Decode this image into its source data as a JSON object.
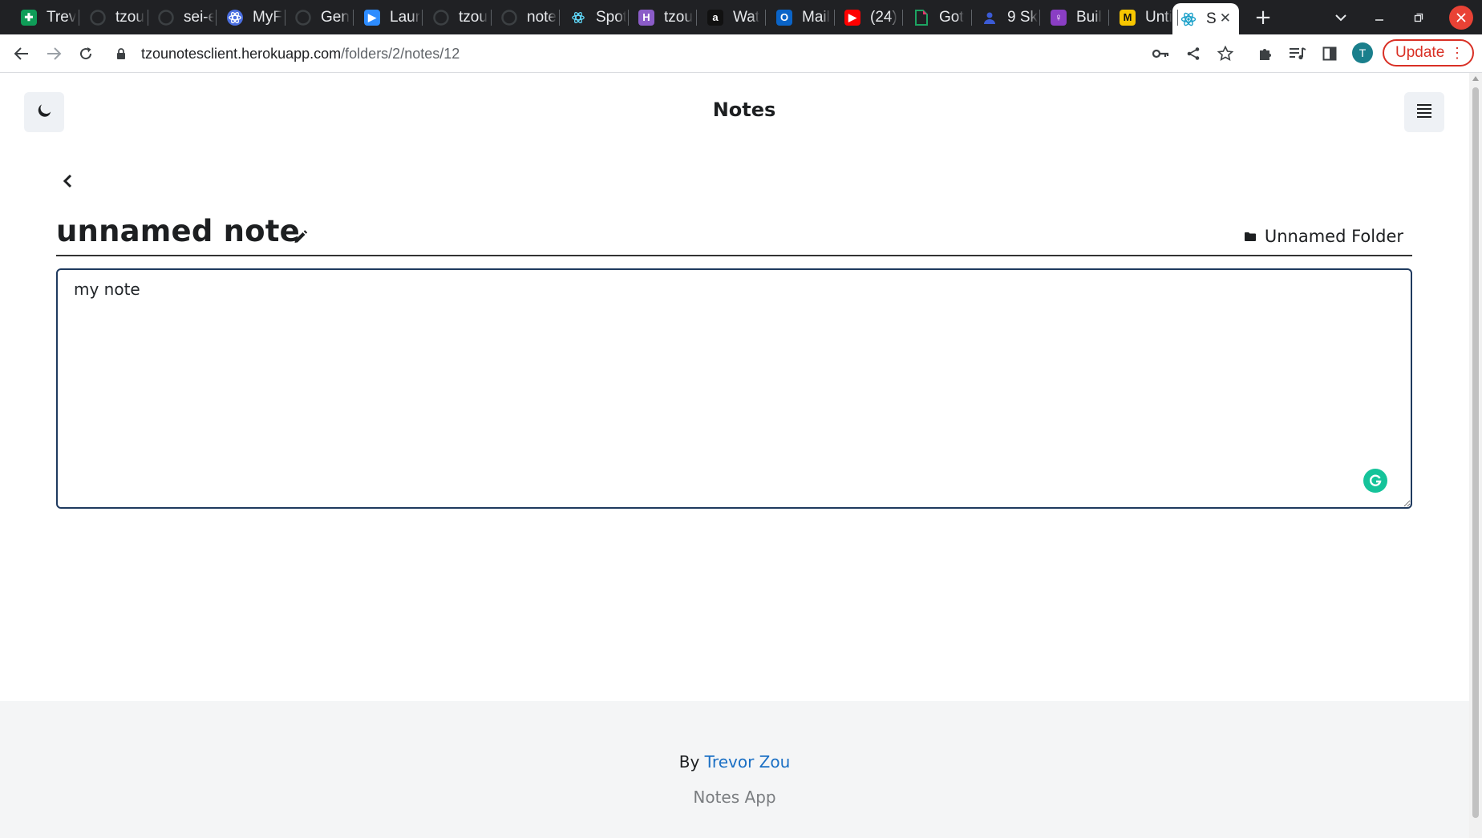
{
  "browser": {
    "tabs": [
      {
        "title": "Trev",
        "icon": "sheets-icon",
        "color": "#0f9d58"
      },
      {
        "title": "tzou",
        "icon": "github-icon",
        "color": "#3c4043"
      },
      {
        "title": "sei-e",
        "icon": "github-icon",
        "color": "#3c4043"
      },
      {
        "title": "MyF",
        "icon": "react-icon",
        "color": "#4a6ee0"
      },
      {
        "title": "Gen",
        "icon": "github-icon",
        "color": "#3c4043"
      },
      {
        "title": "Laur",
        "icon": "zoom-icon",
        "color": "#2d8cff"
      },
      {
        "title": "tzou",
        "icon": "github-icon",
        "color": "#3c4043"
      },
      {
        "title": "note",
        "icon": "github-icon",
        "color": "#3c4043"
      },
      {
        "title": "Spot",
        "icon": "react-icon",
        "color": "#61dafb"
      },
      {
        "title": "tzou",
        "icon": "heroku-icon",
        "color": "#8b5cc8"
      },
      {
        "title": "Wat",
        "icon": "amazon-icon",
        "color": "#111111"
      },
      {
        "title": "Mail",
        "icon": "outlook-icon",
        "color": "#0a64c8"
      },
      {
        "title": "(24)",
        "icon": "youtube-icon",
        "color": "#ff0000"
      },
      {
        "title": "Got",
        "icon": "doc-icon",
        "color": "#1da462"
      },
      {
        "title": "9 Sk",
        "icon": "person-icon",
        "color": "#3b5bd6"
      },
      {
        "title": "Buil",
        "icon": "lightbulb-icon",
        "color": "#8a3ec4"
      },
      {
        "title": "Unti",
        "icon": "miro-icon",
        "color": "#f7c600"
      }
    ],
    "active_tab": {
      "title": "S",
      "icon": "react-icon"
    },
    "url_host": "tzounotesclient.herokuapp.com",
    "url_path": "/folders/2/notes/12",
    "avatar_letter": "T",
    "update_label": "Update"
  },
  "app": {
    "brand": "Notes",
    "note": {
      "title": "unnamed note",
      "folder": "Unnamed Folder",
      "body": "my note"
    },
    "footer": {
      "by_prefix": "By",
      "author": "Trevor Zou",
      "app_name": "Notes App"
    }
  }
}
